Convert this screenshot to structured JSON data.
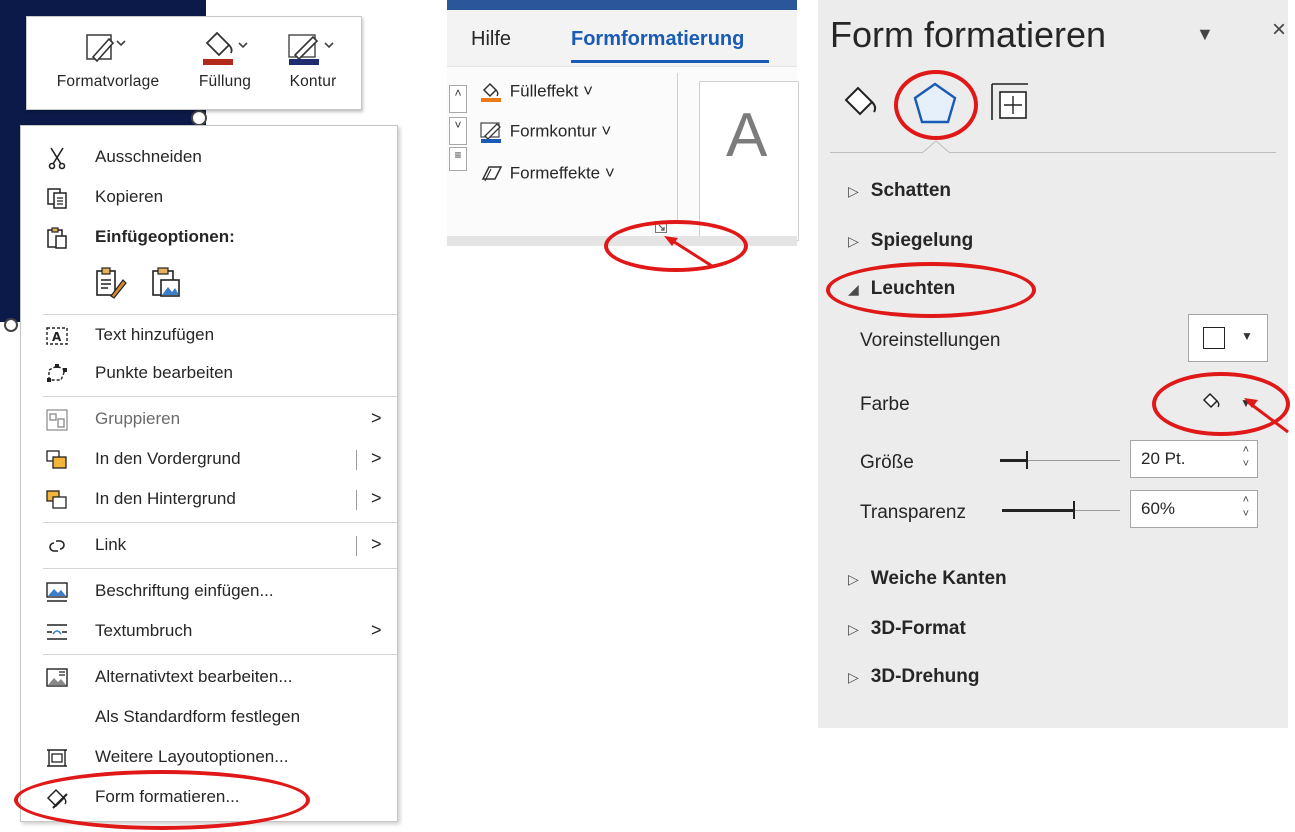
{
  "minibar": {
    "items": [
      {
        "label": "Formatvorlage",
        "icon": "style-pen-icon"
      },
      {
        "label": "Füllung",
        "icon": "fill-bucket-icon",
        "swatch": "#b22a1a"
      },
      {
        "label": "Kontur",
        "icon": "outline-pen-icon",
        "swatch": "#1f2d6e"
      }
    ]
  },
  "context_menu": {
    "items": [
      {
        "label": "Ausschneiden",
        "icon": "scissors-icon"
      },
      {
        "label": "Kopieren",
        "icon": "copy-icon"
      },
      {
        "label": "Einfügeoptionen:",
        "icon": "paste-icon"
      },
      {
        "label": "Text hinzufügen",
        "icon": "add-text-icon"
      },
      {
        "label": "Punkte bearbeiten",
        "icon": "edit-points-icon"
      },
      {
        "label": "Gruppieren",
        "icon": "group-icon",
        "arrow": ">"
      },
      {
        "label": "In den Vordergrund",
        "icon": "bring-forward-icon",
        "arrow": ">"
      },
      {
        "label": "In den Hintergrund",
        "icon": "send-backward-icon",
        "arrow": ">"
      },
      {
        "label": "Link",
        "icon": "link-icon",
        "arrow": ">"
      },
      {
        "label": "Beschriftung einfügen...",
        "icon": "insert-caption-icon"
      },
      {
        "label": "Textumbruch",
        "icon": "text-wrap-icon",
        "arrow": ">"
      },
      {
        "label": "Alternativtext bearbeiten...",
        "icon": "alt-text-icon"
      },
      {
        "label": "Als Standardform festlegen",
        "icon": ""
      },
      {
        "label": "Weitere Layoutoptionen...",
        "icon": "layout-options-icon"
      },
      {
        "label": "Form formatieren...",
        "icon": "format-shape-icon"
      }
    ]
  },
  "ribbon": {
    "tabs": [
      {
        "label": "Hilfe"
      },
      {
        "label": "Formformatierung",
        "active": true
      }
    ],
    "items": [
      {
        "label": "Fülleffekt",
        "caret": "˅"
      },
      {
        "label": "Formkontur",
        "caret": "˅"
      },
      {
        "label": "Formeffekte",
        "caret": "˅"
      }
    ],
    "preview_letter": "A"
  },
  "pane": {
    "title": "Form formatieren",
    "sections_top": [
      {
        "label": "Schatten",
        "tri": "▷"
      },
      {
        "label": "Spiegelung",
        "tri": "▷"
      }
    ],
    "expanded": {
      "label": "Leuchten",
      "tri": "◢"
    },
    "rows": {
      "presets": "Voreinstellungen",
      "color": "Farbe",
      "size": "Größe",
      "size_value": "20 Pt.",
      "transparency": "Transparenz",
      "transparency_value": "60%"
    },
    "sections_bottom": [
      {
        "label": "Weiche Kanten",
        "tri": "▷"
      },
      {
        "label": "3D-Format",
        "tri": "▷"
      },
      {
        "label": "3D-Drehung",
        "tri": "▷"
      }
    ]
  },
  "colors": {
    "accent": "#1a5bb5",
    "annotation": "#e01818",
    "ribbon_tab_bar": "#2b579a"
  }
}
